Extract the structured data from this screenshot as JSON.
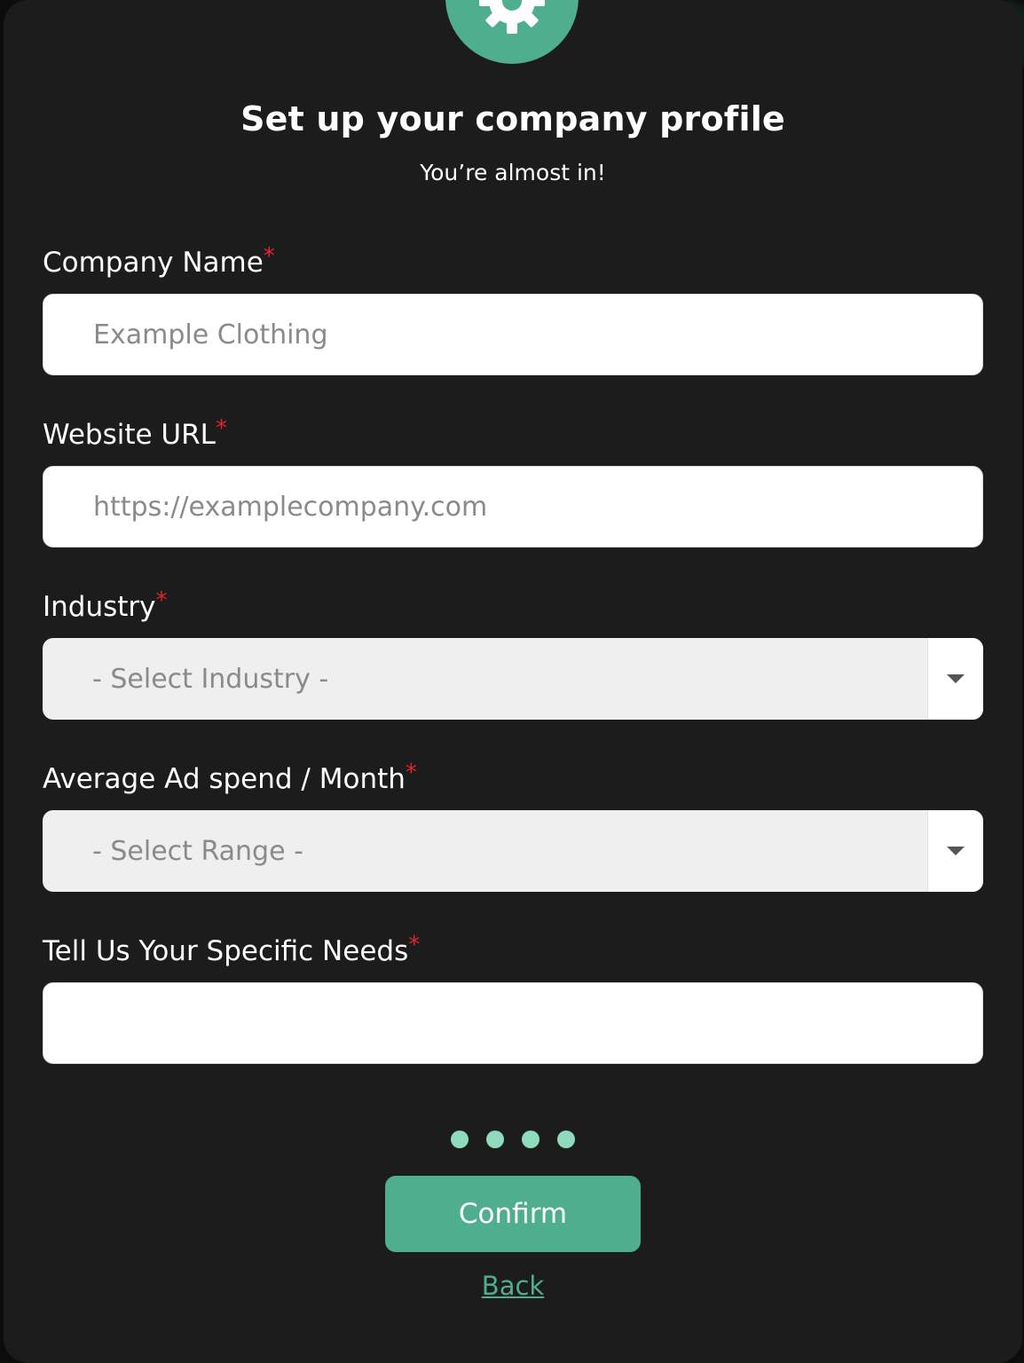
{
  "header": {
    "title": "Set up your company profile",
    "subtitle": "You’re almost in!"
  },
  "fields": {
    "company_name": {
      "label": "Company Name",
      "required_mark": "*",
      "placeholder": "Example Clothing",
      "value": ""
    },
    "website_url": {
      "label": "Website URL",
      "required_mark": "*",
      "placeholder": "https://examplecompany.com",
      "value": ""
    },
    "industry": {
      "label": "Industry",
      "required_mark": "*",
      "selected": "- Select Industry -"
    },
    "ad_spend": {
      "label": "Average Ad spend / Month",
      "required_mark": "*",
      "selected": "- Select Range -"
    },
    "needs": {
      "label": "Tell Us Your Specific Needs",
      "required_mark": "*",
      "placeholder": "",
      "value": ""
    }
  },
  "progress": {
    "total_steps": 4
  },
  "actions": {
    "confirm_label": "Confirm",
    "back_label": "Back"
  },
  "colors": {
    "accent": "#4fae8d",
    "dot": "#8fd9bd",
    "required": "#e0262b",
    "modal_bg": "#1c1c1c"
  },
  "icons": {
    "badge": "gear-icon",
    "select_caret": "chevron-down-icon"
  }
}
